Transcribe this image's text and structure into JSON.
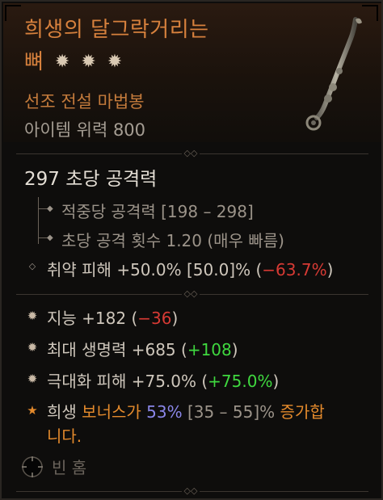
{
  "item": {
    "name_line1": "희생의 달그락거리는",
    "name_line2": "뼈",
    "stars": [
      "✹",
      "✹",
      "✹"
    ],
    "type": "선조 전설 마법봉",
    "power": "아이템 위력 800"
  },
  "offense": {
    "dps": "297 초당 공격력",
    "damage_per_hit": "적중당 공격력 [198 – 298]",
    "attack_speed": "초당 공격 횟수 1.20 (매우 빠름)",
    "vuln_prefix": "취약 피해 +50.0% [50.0]% (",
    "vuln_delta": "−63.7%",
    "vuln_suffix": ")"
  },
  "affixes": [
    {
      "bullet": "✹",
      "text": "지능 +182 (",
      "delta": "−36",
      "delta_color": "red",
      "suffix": ")"
    },
    {
      "bullet": "✹",
      "text": "최대 생명력 +685 (",
      "delta": "+108",
      "delta_color": "green",
      "suffix": ")"
    },
    {
      "bullet": "✹",
      "text": "극대화 피해 +75.0% (",
      "delta": "+75.0%",
      "delta_color": "green",
      "suffix": ")"
    }
  ],
  "aspect": {
    "bullet": "★",
    "p1": "희생 ",
    "p2": "보너스가 ",
    "p3": "53%",
    "p4": " [35 – 55]%",
    "p5": " 증가합",
    "p6": "니다."
  },
  "socket": {
    "label": "빈 홈"
  },
  "colors": {
    "title": "#d7813d",
    "legendary": "#e48a2c",
    "negative": "#d73a34",
    "positive": "#3fd83f",
    "range": "#9b9389",
    "highlight": "#8a86e8"
  },
  "icons": {
    "affix_bullet": "diamond-star-icon",
    "aspect_bullet": "orange-star-icon",
    "socket": "empty-socket-icon",
    "weapon": "staff-wand-image"
  }
}
